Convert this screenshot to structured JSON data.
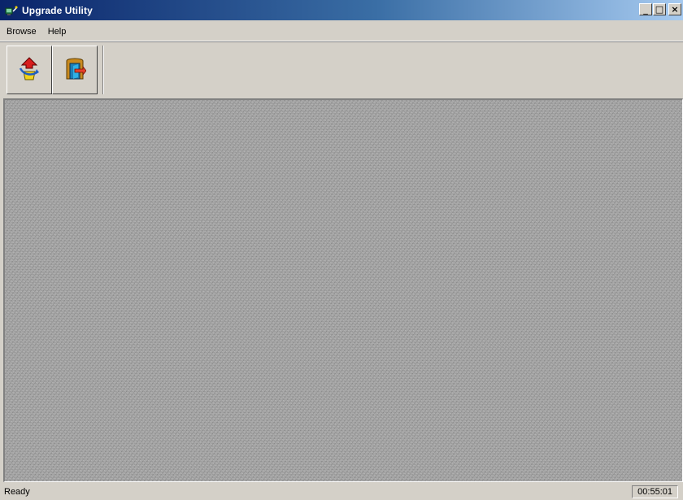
{
  "window": {
    "title": "Upgrade Utility",
    "controls": {
      "minimize": "_",
      "maximize": "□",
      "close": "×"
    },
    "app_icon": "network-icon"
  },
  "menu": {
    "items": [
      "Browse",
      "Help"
    ]
  },
  "toolbar": {
    "buttons": [
      {
        "icon": "upgrade-icon",
        "label": "Upgrade"
      },
      {
        "icon": "exit-door-icon",
        "label": "Exit"
      }
    ]
  },
  "status": {
    "text": "Ready",
    "time": "00:55:01"
  },
  "colors": {
    "titlebar_start": "#0a246a",
    "titlebar_end": "#a6caf0",
    "chrome": "#d4d0c8",
    "client": "#a6a6a6"
  }
}
